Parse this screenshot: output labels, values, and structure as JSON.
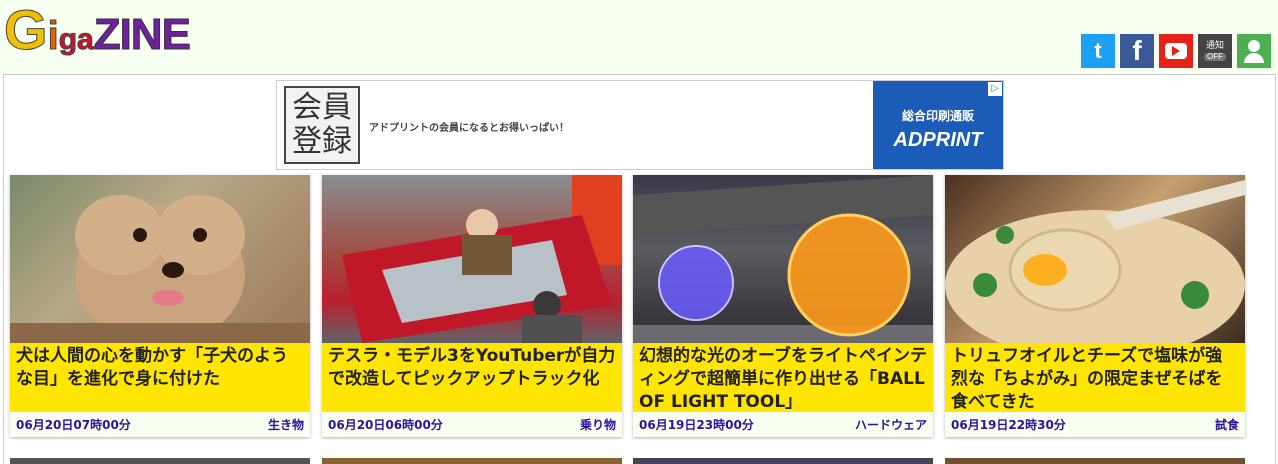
{
  "header": {
    "logo": {
      "c1": "G",
      "c2": "i",
      "c3": "ga",
      "c4": "ZINE"
    },
    "social": {
      "twitter": "t",
      "facebook": "f",
      "notify_label": "通知",
      "notify_state": "OFF"
    }
  },
  "ad": {
    "badge_line1": "会員",
    "badge_line2": "登録",
    "text": "アドプリントの会員になるとお得いっぱい！",
    "brand_sub": "総合印刷通販",
    "brand_name": "ADPRINT"
  },
  "articles": [
    {
      "title": "犬は人間の心を動かす「子犬のような目」を進化で身に付けた",
      "date": "06月20日07時00分",
      "category": "生き物"
    },
    {
      "title": "テスラ・モデル3をYouTuberが自力で改造してピックアップトラック化",
      "date": "06月20日06時00分",
      "category": "乗り物"
    },
    {
      "title": "幻想的な光のオーブをライトペインティングで超簡単に作り出せる「BALL OF LIGHT TOOL」",
      "date": "06月19日23時00分",
      "category": "ハードウェア"
    },
    {
      "title": "トリュフオイルとチーズで塩味が強烈な「ちよがみ」の限定まぜそばを食べてきた",
      "date": "06月19日22時30分",
      "category": "試食"
    }
  ],
  "colors": {
    "title_bg": "#ffe500",
    "meta_text": "#3010a0",
    "header_bg": "#f6fff0"
  }
}
